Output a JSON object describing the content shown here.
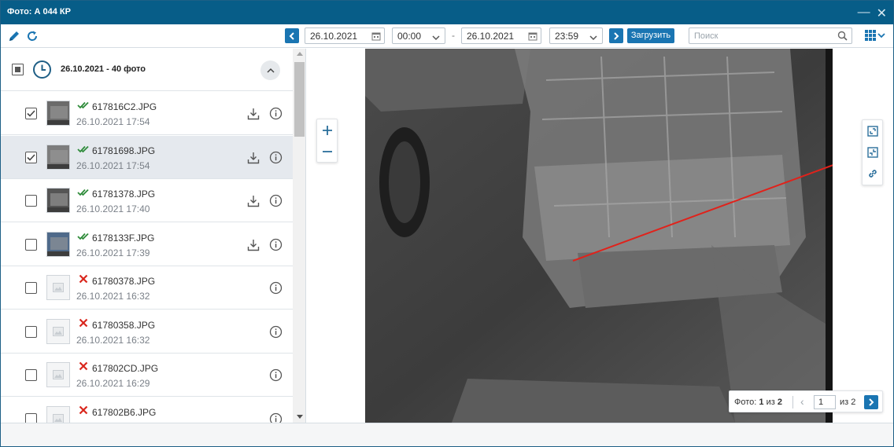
{
  "window": {
    "title": "Фото: А 044 КР",
    "minimize_glyph": "—",
    "close_glyph": "✕"
  },
  "toolbar": {
    "date_from": "26.10.2021",
    "time_from": "00:00",
    "date_to": "26.10.2021",
    "time_to": "23:59",
    "range_dash": "-",
    "load_label": "Загрузить",
    "search_placeholder": "Поиск"
  },
  "group": {
    "title": "26.10.2021 - 40 фото"
  },
  "items": [
    {
      "name": "617816C2.JPG",
      "datetime": "26.10.2021 17:54",
      "checked": true,
      "loaded": true,
      "selected": false
    },
    {
      "name": "61781698.JPG",
      "datetime": "26.10.2021 17:54",
      "checked": true,
      "loaded": true,
      "selected": true
    },
    {
      "name": "61781378.JPG",
      "datetime": "26.10.2021 17:40",
      "checked": false,
      "loaded": true,
      "selected": false
    },
    {
      "name": "6178133F.JPG",
      "datetime": "26.10.2021 17:39",
      "checked": false,
      "loaded": true,
      "selected": false
    },
    {
      "name": "61780378.JPG",
      "datetime": "26.10.2021 16:32",
      "checked": false,
      "loaded": false,
      "selected": false
    },
    {
      "name": "61780358.JPG",
      "datetime": "26.10.2021 16:32",
      "checked": false,
      "loaded": false,
      "selected": false
    },
    {
      "name": "617802CD.JPG",
      "datetime": "26.10.2021 16:29",
      "checked": false,
      "loaded": false,
      "selected": false
    },
    {
      "name": "617802B6.JPG",
      "datetime": "",
      "checked": false,
      "loaded": false,
      "selected": false
    }
  ],
  "pager": {
    "label": "Фото:",
    "current": "1",
    "of_word": "из",
    "total": "2",
    "page_input": "1",
    "page_total": "из 2"
  },
  "colors": {
    "accent": "#1a75b2",
    "title_bar": "#075d88",
    "ok_check": "#2e8b3a",
    "error_x": "#d9261c",
    "annotation_arrow": "#e0221b"
  },
  "icons": {
    "edit": "pencil-icon",
    "refresh": "refresh-icon",
    "calendar": "calendar-icon",
    "search": "search-icon",
    "grid": "grid-icon",
    "clock": "clock-icon",
    "download": "download-icon",
    "info": "info-icon",
    "fullscreen": "fullscreen-icon",
    "fit": "fit-icon",
    "link": "link-icon"
  }
}
